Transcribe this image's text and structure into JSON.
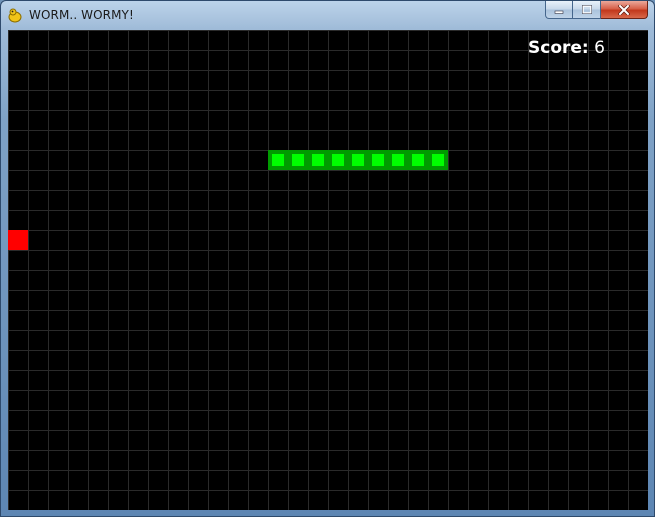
{
  "window": {
    "title": "WORM.. WORMY!",
    "app_icon": "pygame-snake-icon",
    "controls": [
      "minimize-icon",
      "maximize-icon",
      "close-icon"
    ]
  },
  "game": {
    "grid": {
      "columns": 32,
      "rows": 24
    },
    "score_label": "Score:",
    "score_value": "6",
    "worm": {
      "head": {
        "col": 21,
        "row": 6
      },
      "cells": [
        {
          "col": 21,
          "row": 6
        },
        {
          "col": 20,
          "row": 6
        },
        {
          "col": 19,
          "row": 6
        },
        {
          "col": 18,
          "row": 6
        },
        {
          "col": 17,
          "row": 6
        },
        {
          "col": 16,
          "row": 6
        },
        {
          "col": 15,
          "row": 6
        },
        {
          "col": 14,
          "row": 6
        },
        {
          "col": 13,
          "row": 6
        }
      ]
    },
    "apple": {
      "col": 0,
      "row": 10
    },
    "colors": {
      "background": "#000000",
      "grid": "#2a2a2a",
      "worm_outer": "#009b00",
      "worm_inner": "#00ff00",
      "apple": "#ff0000",
      "text": "#ffffff"
    }
  }
}
